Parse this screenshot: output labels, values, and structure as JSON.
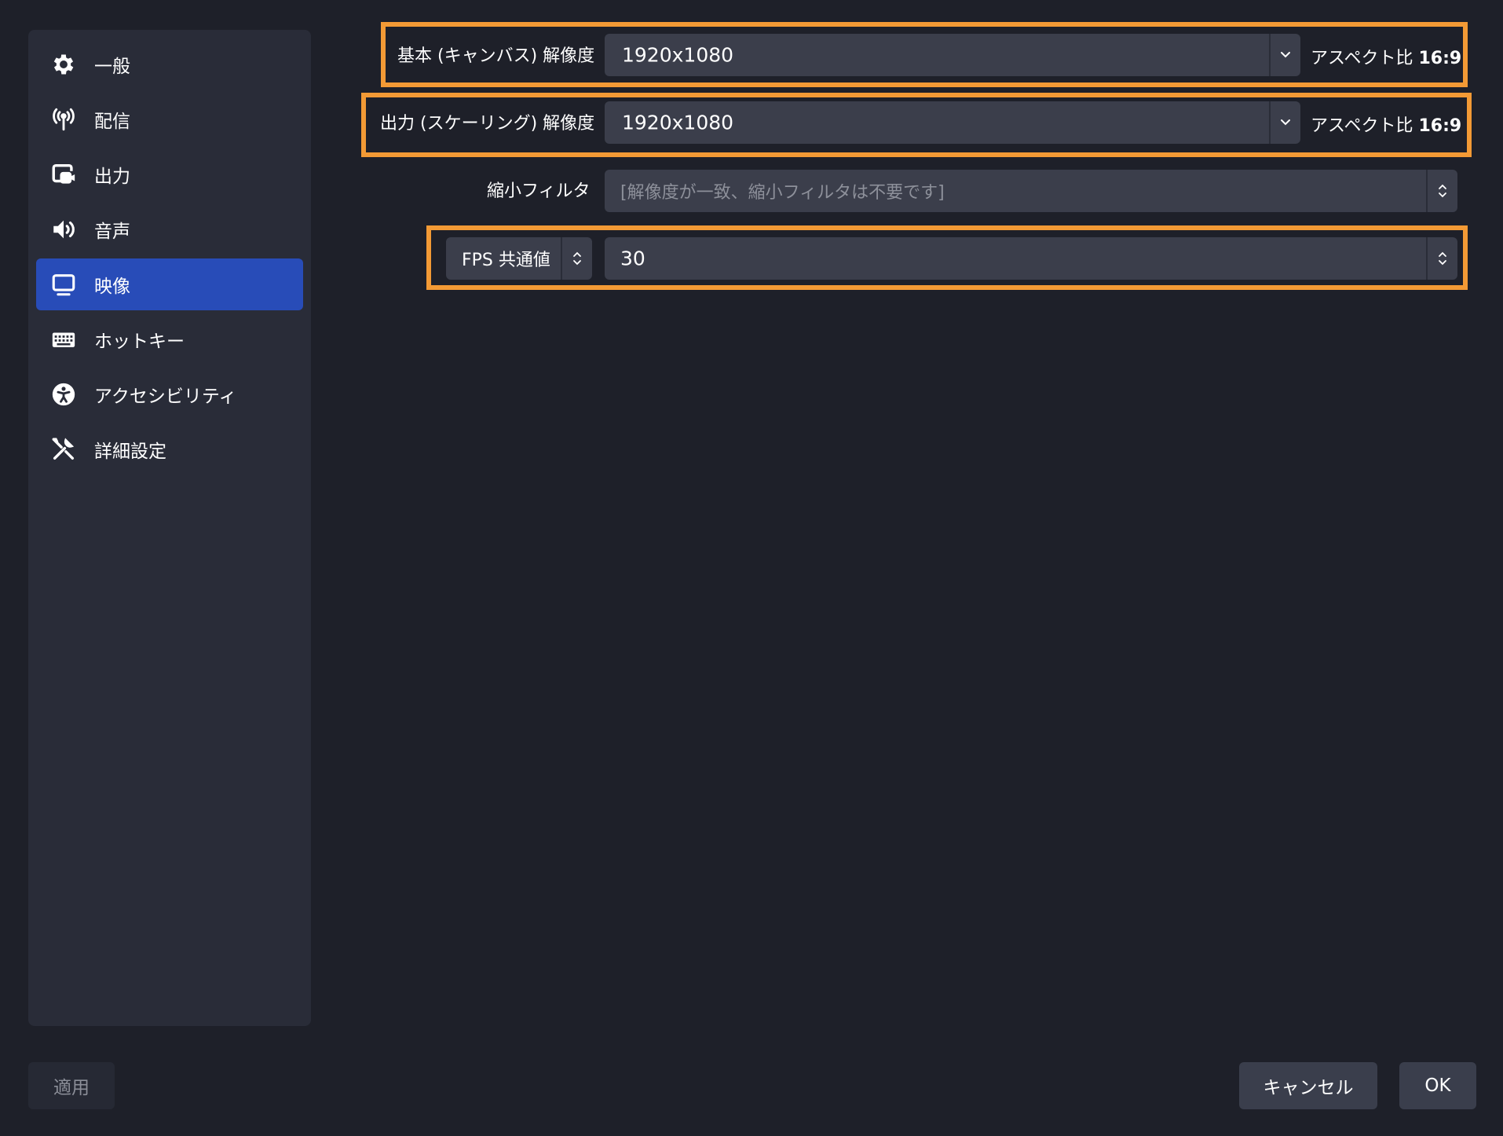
{
  "sidebar": {
    "items": [
      {
        "label": "一般",
        "icon": "gear-icon"
      },
      {
        "label": "配信",
        "icon": "antenna-icon"
      },
      {
        "label": "出力",
        "icon": "output-icon"
      },
      {
        "label": "音声",
        "icon": "speaker-icon"
      },
      {
        "label": "映像",
        "icon": "monitor-icon",
        "active": true
      },
      {
        "label": "ホットキー",
        "icon": "keyboard-icon"
      },
      {
        "label": "アクセシビリティ",
        "icon": "accessibility-icon"
      },
      {
        "label": "詳細設定",
        "icon": "tools-icon"
      }
    ]
  },
  "video": {
    "base_resolution": {
      "label": "基本 (キャンバス) 解像度",
      "value": "1920x1080",
      "aspect_prefix": "アスペクト比",
      "aspect_value": "16:9"
    },
    "output_resolution": {
      "label": "出力 (スケーリング) 解像度",
      "value": "1920x1080",
      "aspect_prefix": "アスペクト比",
      "aspect_value": "16:9"
    },
    "downscale_filter": {
      "label": "縮小フィルタ",
      "value": "[解像度が一致、縮小フィルタは不要です]"
    },
    "fps": {
      "type_label": "FPS 共通値",
      "value": "30"
    }
  },
  "footer": {
    "apply_label": "適用",
    "cancel_label": "キャンセル",
    "ok_label": "OK"
  },
  "colors": {
    "background": "#1e2029",
    "sidebar": "#292c38",
    "active": "#284cb8",
    "field": "#3b3e4b",
    "highlight": "#f39a35"
  }
}
